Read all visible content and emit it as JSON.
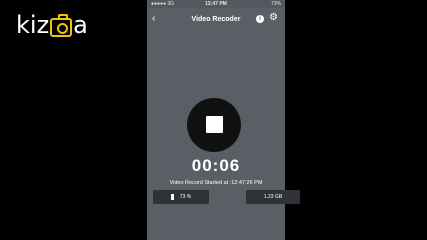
{
  "branding": {
    "logo_prefix": "kiz",
    "logo_suffix": "a"
  },
  "status_bar": {
    "carrier": "●●●●● 3G",
    "time": "12:47 PM",
    "battery": "73%"
  },
  "header": {
    "title": "Video Recoder",
    "back_icon": "chevron-left-icon",
    "info_icon": "info-icon",
    "settings_icon": "gear-icon"
  },
  "recorder": {
    "timer": "00:06",
    "started_text": "Video Record Started at :12:47:26 PM",
    "battery_label": "73 %",
    "size_label": "1.23 GB"
  }
}
